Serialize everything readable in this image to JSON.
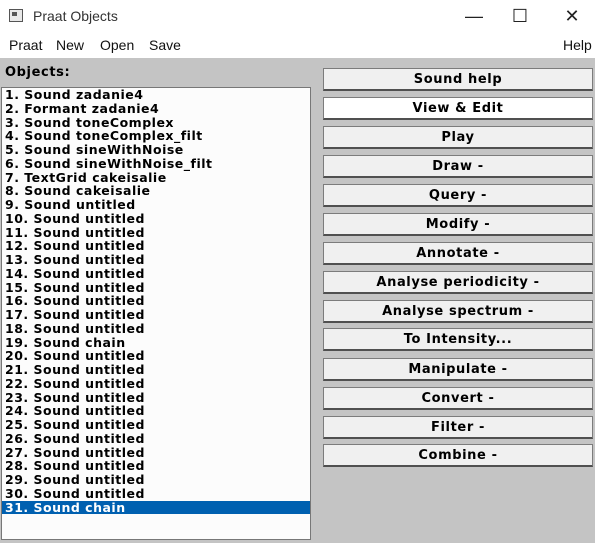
{
  "window": {
    "title": "Praat Objects",
    "minimize": "—",
    "maximize": "☐",
    "close": "✕"
  },
  "menu": [
    "Praat",
    "New",
    "Open",
    "Save",
    "Help"
  ],
  "objects_label": "Objects:",
  "objects": [
    "1. Sound zadanie4",
    "2. Formant zadanie4",
    "3. Sound toneComplex",
    "4. Sound toneComplex_filt",
    "5. Sound sineWithNoise",
    "6. Sound sineWithNoise_filt",
    "7. TextGrid cakeisalie",
    "8. Sound cakeisalie",
    "9. Sound untitled",
    "10. Sound untitled",
    "11. Sound untitled",
    "12. Sound untitled",
    "13. Sound untitled",
    "14. Sound untitled",
    "15. Sound untitled",
    "16. Sound untitled",
    "17. Sound untitled",
    "18. Sound untitled",
    "19. Sound chain",
    "20. Sound untitled",
    "21. Sound untitled",
    "22. Sound untitled",
    "23. Sound untitled",
    "24. Sound untitled",
    "25. Sound untitled",
    "26. Sound untitled",
    "27. Sound untitled",
    "28. Sound untitled",
    "29. Sound untitled",
    "30. Sound untitled",
    "31. Sound chain"
  ],
  "selected_index": 30,
  "buttons": [
    "Sound help",
    "View & Edit",
    "Play",
    "Draw -",
    "Query -",
    "Modify -",
    "Annotate -",
    "Analyse periodicity -",
    "Analyse spectrum -",
    "To Intensity...",
    "Manipulate -",
    "Convert -",
    "Filter -",
    "Combine -"
  ],
  "colors": {
    "selection": "#0060b0",
    "panel": "#c4c4c4"
  }
}
